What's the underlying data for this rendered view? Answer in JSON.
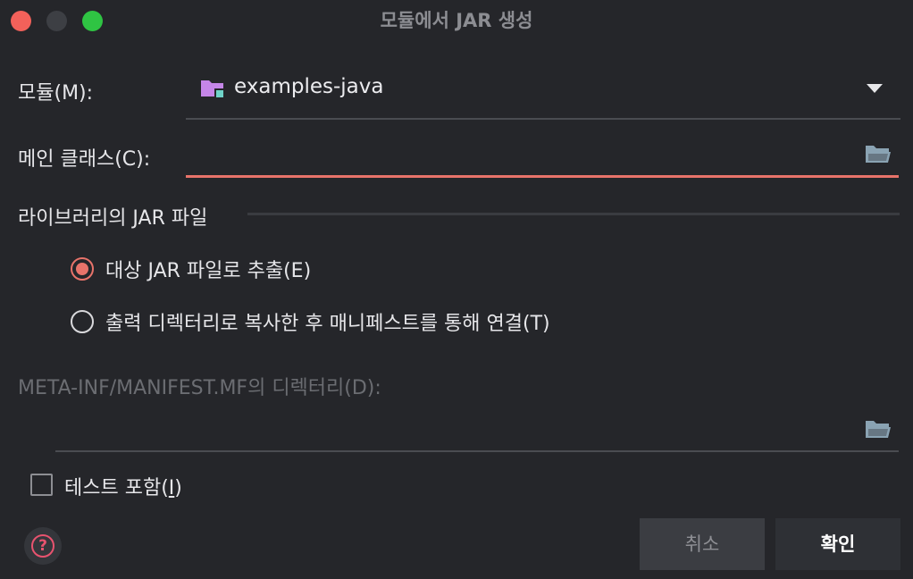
{
  "window": {
    "title": "모듈에서 JAR 생성"
  },
  "module": {
    "label": "모듈(M):",
    "value": "examples-java",
    "icon": "module-folder-icon"
  },
  "main_class": {
    "label": "메인 클래스(C):",
    "value": "",
    "icon": "folder-open-icon"
  },
  "libraries": {
    "section_title": "라이브러리의 JAR 파일",
    "options": [
      {
        "label": "대상 JAR 파일로 추출(E)",
        "selected": true
      },
      {
        "label": "출력 디렉터리로 복사한 후 매니페스트를 통해 연결(T)",
        "selected": false
      }
    ]
  },
  "manifest": {
    "label": "META-INF/MANIFEST.MF의 디렉터리(D):",
    "value": "",
    "icon": "folder-open-icon"
  },
  "include_tests": {
    "label_prefix": "테스트 포함(",
    "label_mnemonic": "I",
    "label_suffix": ")",
    "checked": false
  },
  "buttons": {
    "cancel": "취소",
    "ok": "확인"
  },
  "help": {
    "glyph": "?",
    "icon": "help-icon"
  },
  "colors": {
    "accent": "#e8736a",
    "background": "#25262a",
    "module_icon": "#c586e8",
    "folder_icon": "#8aa3b3"
  }
}
